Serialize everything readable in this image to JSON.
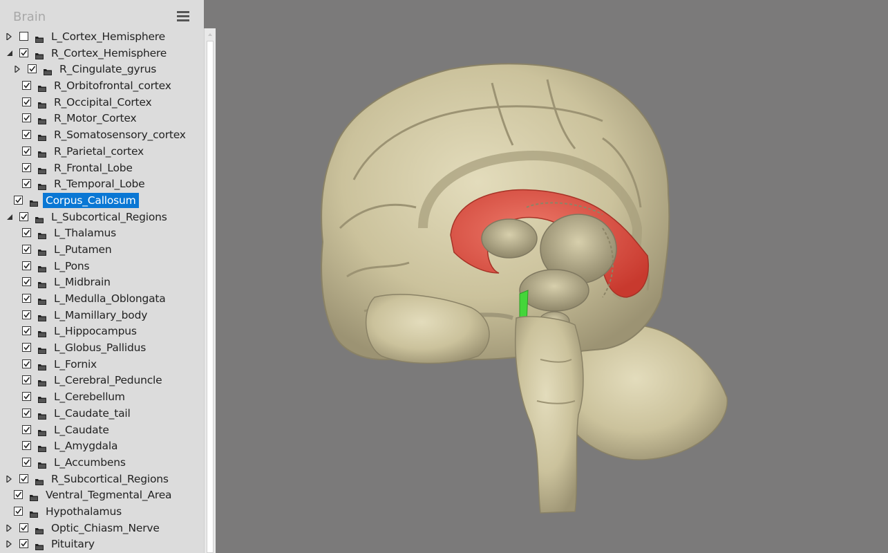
{
  "sidebar": {
    "title": "Brain",
    "items": [
      {
        "label": "L_Cortex_Hemisphere",
        "level": 0,
        "expander": "collapsed",
        "checked": false,
        "selected": false
      },
      {
        "label": "R_Cortex_Hemisphere",
        "level": 0,
        "expander": "expanded",
        "checked": true,
        "selected": false
      },
      {
        "label": "R_Cingulate_gyrus",
        "level": 1,
        "expander": "collapsed",
        "checked": true,
        "selected": false
      },
      {
        "label": "R_Orbitofrontal_cortex",
        "level": 2,
        "expander": "none",
        "checked": true,
        "selected": false
      },
      {
        "label": "R_Occipital_Cortex",
        "level": 2,
        "expander": "none",
        "checked": true,
        "selected": false
      },
      {
        "label": "R_Motor_Cortex",
        "level": 2,
        "expander": "none",
        "checked": true,
        "selected": false
      },
      {
        "label": "R_Somatosensory_cortex",
        "level": 2,
        "expander": "none",
        "checked": true,
        "selected": false
      },
      {
        "label": "R_Parietal_cortex",
        "level": 2,
        "expander": "none",
        "checked": true,
        "selected": false
      },
      {
        "label": "R_Frontal_Lobe",
        "level": 2,
        "expander": "none",
        "checked": true,
        "selected": false
      },
      {
        "label": "R_Temporal_Lobe",
        "level": 2,
        "expander": "none",
        "checked": true,
        "selected": false
      },
      {
        "label": "Corpus_Callosum",
        "level": 1,
        "expander": "none",
        "checked": true,
        "selected": true
      },
      {
        "label": "L_Subcortical_Regions",
        "level": 0,
        "expander": "expanded",
        "checked": true,
        "selected": false
      },
      {
        "label": "L_Thalamus",
        "level": 2,
        "expander": "none",
        "checked": true,
        "selected": false
      },
      {
        "label": "L_Putamen",
        "level": 2,
        "expander": "none",
        "checked": true,
        "selected": false
      },
      {
        "label": "L_Pons",
        "level": 2,
        "expander": "none",
        "checked": true,
        "selected": false
      },
      {
        "label": "L_Midbrain",
        "level": 2,
        "expander": "none",
        "checked": true,
        "selected": false
      },
      {
        "label": "L_Medulla_Oblongata",
        "level": 2,
        "expander": "none",
        "checked": true,
        "selected": false
      },
      {
        "label": "L_Mamillary_body",
        "level": 2,
        "expander": "none",
        "checked": true,
        "selected": false
      },
      {
        "label": "L_Hippocampus",
        "level": 2,
        "expander": "none",
        "checked": true,
        "selected": false
      },
      {
        "label": "L_Globus_Pallidus",
        "level": 2,
        "expander": "none",
        "checked": true,
        "selected": false
      },
      {
        "label": "L_Fornix",
        "level": 2,
        "expander": "none",
        "checked": true,
        "selected": false
      },
      {
        "label": "L_Cerebral_Peduncle",
        "level": 2,
        "expander": "none",
        "checked": true,
        "selected": false
      },
      {
        "label": "L_Cerebellum",
        "level": 2,
        "expander": "none",
        "checked": true,
        "selected": false
      },
      {
        "label": "L_Caudate_tail",
        "level": 2,
        "expander": "none",
        "checked": true,
        "selected": false
      },
      {
        "label": "L_Caudate",
        "level": 2,
        "expander": "none",
        "checked": true,
        "selected": false
      },
      {
        "label": "L_Amygdala",
        "level": 2,
        "expander": "none",
        "checked": true,
        "selected": false
      },
      {
        "label": "L_Accumbens",
        "level": 2,
        "expander": "none",
        "checked": true,
        "selected": false
      },
      {
        "label": "R_Subcortical_Regions",
        "level": 0,
        "expander": "collapsed",
        "checked": true,
        "selected": false
      },
      {
        "label": "Ventral_Tegmental_Area",
        "level": 1,
        "expander": "none",
        "checked": true,
        "selected": false
      },
      {
        "label": "Hypothalamus",
        "level": 1,
        "expander": "none",
        "checked": true,
        "selected": false
      },
      {
        "label": "Optic_Chiasm_Nerve",
        "level": 0,
        "expander": "collapsed",
        "checked": true,
        "selected": false
      },
      {
        "label": "Pituitary",
        "level": 0,
        "expander": "collapsed",
        "checked": true,
        "selected": false
      }
    ]
  },
  "icons": {
    "menu": "hamburger-menu-icon",
    "expand": "triangle-right-icon",
    "collapse": "triangle-down-icon",
    "check": "checkmark-icon",
    "folder": "folder-icon",
    "scroll_up": "scroll-up-arrow-icon"
  },
  "colors": {
    "sidebar_bg": "#dcdcdc",
    "viewport_bg": "#7b7a7a",
    "selection": "#0a77d4",
    "brain_tissue": "#cfc6a2",
    "corpus_callosum_highlight": "#e25a4b",
    "hypothalamus_highlight": "#44d63a"
  },
  "viewport": {
    "model": "3D brain model, sagittal cut",
    "highlighted_structures": [
      "Corpus_Callosum",
      "Hypothalamus"
    ]
  }
}
